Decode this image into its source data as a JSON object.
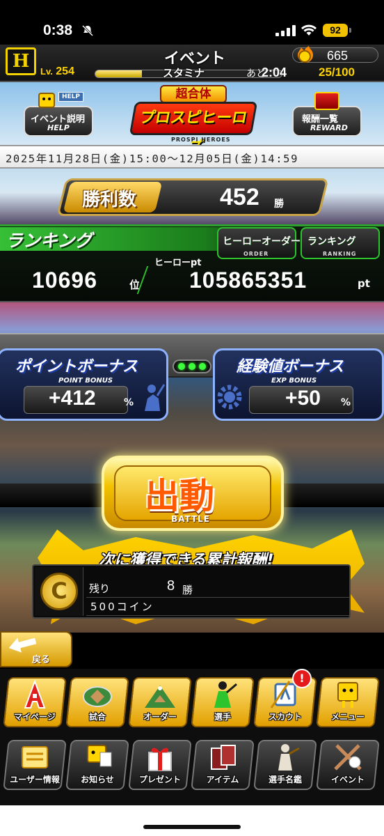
{
  "status_bar": {
    "time": "0:38",
    "battery": "92",
    "icons": [
      "bell-muted-icon",
      "signal-icon",
      "wifi-icon",
      "battery-icon"
    ]
  },
  "header": {
    "team_logo": "H",
    "title": "イベント",
    "coins": "665",
    "level_prefix": "Lv.",
    "level": "254",
    "stamina_label": "スタミナ",
    "recover_label": "あと",
    "recover_time": "2:04",
    "stamina_value": "25/100",
    "stamina_fraction": 0.25
  },
  "banner": {
    "help_tag": "HELP",
    "help_label": "イベント説明",
    "help_sub": "HELP",
    "logo_top": "超合体",
    "logo_main": "プロスピヒーローズ",
    "logo_sub": "PROSPI HEROES",
    "reward_label": "報酬一覧",
    "reward_sub": "REWARD",
    "period": "2025年11月28日(金)15:00～12月05日(金)14:59"
  },
  "wins": {
    "label": "勝利数",
    "value": "452",
    "unit": "勝"
  },
  "ranking": {
    "title": "ランキング",
    "order_button": "ヒーローオーダー",
    "order_sub": "ORDER",
    "ranking_button": "ランキング",
    "ranking_sub": "RANKING",
    "pt_label": "ヒーローpt",
    "rank": "10696",
    "rank_unit": "位",
    "points": "105865351",
    "points_unit": "pt"
  },
  "bonuses": {
    "point": {
      "title": "ポイントボーナス",
      "sub": "POINT BONUS",
      "value": "+412",
      "unit": "%"
    },
    "exp": {
      "title": "経験値ボーナス",
      "sub": "EXP BONUS",
      "value": "+50",
      "unit": "%"
    }
  },
  "battle": {
    "label": "出動",
    "sub": "BATTLE"
  },
  "next_reward": {
    "heading": "次に獲得できる累計報酬!",
    "coin_symbol": "C",
    "remaining_label": "残り",
    "remaining_value": "8",
    "remaining_unit": "勝",
    "item": "500コイン"
  },
  "back": {
    "label": "戻る"
  },
  "menu_row1": [
    {
      "label": "マイページ",
      "icon": "mypage-icon"
    },
    {
      "label": "試合",
      "icon": "stadium-icon"
    },
    {
      "label": "オーダー",
      "icon": "field-icon"
    },
    {
      "label": "選手",
      "icon": "player-icon"
    },
    {
      "label": "スカウト",
      "icon": "scout-icon"
    },
    {
      "label": "メニュー",
      "icon": "menu-mascot-icon"
    }
  ],
  "scout_badge": "!",
  "menu_row2": [
    {
      "label": "ユーザー情報",
      "icon": "user-info-icon"
    },
    {
      "label": "お知らせ",
      "icon": "news-icon"
    },
    {
      "label": "プレゼント",
      "icon": "gift-icon"
    },
    {
      "label": "アイテム",
      "icon": "item-icon"
    },
    {
      "label": "選手名鑑",
      "icon": "player-book-icon"
    },
    {
      "label": "イベント",
      "icon": "event-bat-icon"
    }
  ],
  "colors": {
    "gold": "#ffd400",
    "ranking_green": "#2ec42e",
    "bonus_blue": "#8fb2ff",
    "battle_orange": "#ff5a00"
  }
}
